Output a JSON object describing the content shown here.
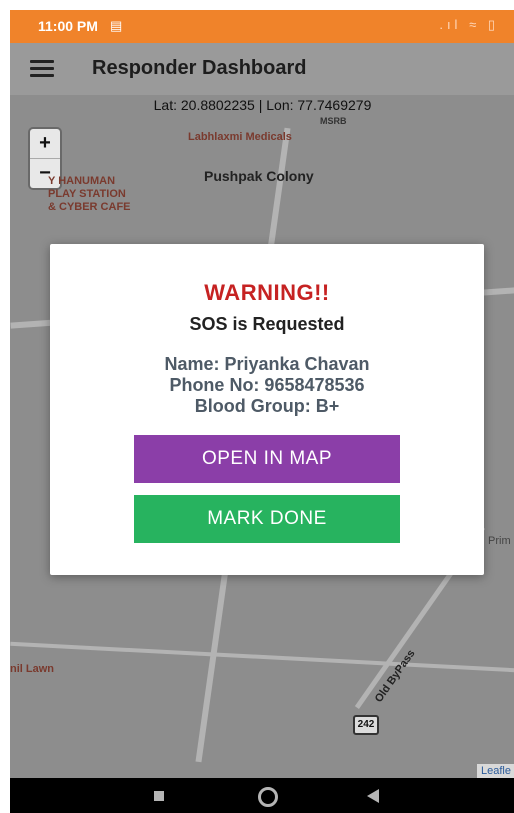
{
  "status_bar": {
    "time": "11:00 PM",
    "left_icon": "notification-icon",
    "right_icons": "signal-icon wifi-icon battery-icon",
    "color": "#f0832a"
  },
  "app_bar": {
    "title": "Responder Dashboard",
    "menu_icon": "hamburger-menu-icon"
  },
  "map": {
    "coordinates": "Lat: 20.8802235 | Lon: 77.7469279",
    "zoom_in": "+",
    "zoom_out": "−",
    "labels": {
      "medicals": "Labhlaxmi Medicals",
      "hanuman": "Y HANUMAN\nPLAY STATION\n& CYBER CAFE",
      "colony": "Pushpak Colony",
      "lawn": "nil Lawn",
      "bypass": "Old ByPass",
      "prim": "Prim",
      "highway": "242",
      "attribution": "Leafle",
      "msrb": "MSRB"
    }
  },
  "dialog": {
    "warning": "WARNING!!",
    "subtitle": "SOS is Requested",
    "name": "Name: Priyanka Chavan",
    "phone": "Phone No: 9658478536",
    "blood_group": "Blood Group: B+",
    "open_map_label": "OPEN IN MAP",
    "mark_done_label": "MARK DONE",
    "colors": {
      "warning": "#c62222",
      "open_map": "#8b3ea8",
      "mark_done": "#27b35f"
    }
  },
  "nav_bar": {
    "recents_icon": "square-recents-icon",
    "home_icon": "circle-home-icon",
    "back_icon": "triangle-back-icon"
  }
}
